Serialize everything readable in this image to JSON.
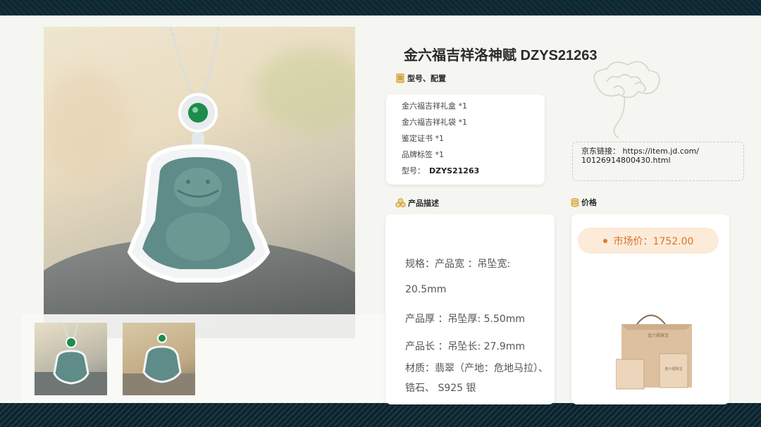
{
  "title": "金六福吉祥洛神赋 DZYS21263",
  "config_section": {
    "heading": "型号、配置",
    "items": [
      "金六福吉祥礼盒 *1",
      "金六福吉祥礼袋 *1",
      "鉴定证书 *1",
      "品牌标签 *1"
    ],
    "model_label": "型号：",
    "model_value": "DZYS21263"
  },
  "jd_link": {
    "label": "京东链接：",
    "url_part1": "https://item.jd.com/",
    "url_part2": "10126914800430.html"
  },
  "description_section": {
    "heading": "产品描述",
    "lines": [
      "规格：产品宽 ：吊坠宽:",
      "20.5mm",
      "产品厚 ：吊坠厚:   5.50mm",
      "产品长 ：吊坠长:   27.9mm",
      "材质：翡翠（产地：危地马拉）、",
      "锆石、 S925 银"
    ]
  },
  "price_section": {
    "heading": "价格",
    "market_price": "市场价：1752.00"
  },
  "gift_bag_text": "金六福珠宝",
  "colors": {
    "accent_orange": "#e07a2f",
    "price_pill": "#fcebd9",
    "icon_gold": "#c89a3c",
    "background": "#f5f6f1",
    "frame": "#0f2630"
  },
  "icons": [
    "document-icon",
    "flower-icon",
    "coins-icon",
    "cloud-ornament-icon"
  ]
}
